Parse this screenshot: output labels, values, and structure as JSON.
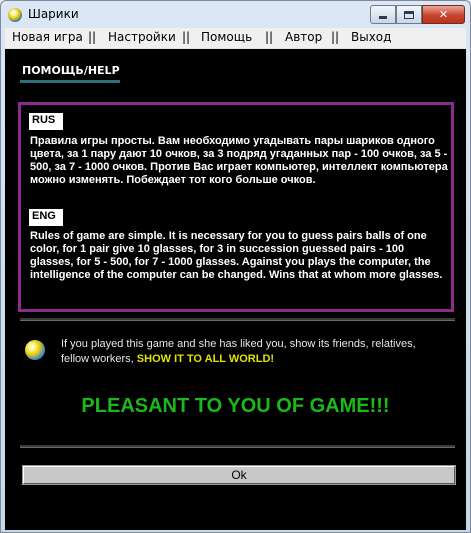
{
  "window": {
    "title": "Шарики",
    "close_glyph": "✕"
  },
  "menu": {
    "items": [
      {
        "label": "Новая игра"
      },
      {
        "label": "Настройки"
      },
      {
        "label": "Помощь"
      },
      {
        "label": "Автор"
      },
      {
        "label": "Выход"
      }
    ],
    "separator": "||"
  },
  "help": {
    "tab_label": "ПОМОЩЬ/HELP",
    "rus_tag": "RUS",
    "rus_text": "Правила игры просты. Вам необходимо угадывать пары шариков одного цвета, за 1 пару дают 10 очков, за 3 подряд угаданных пар - 100 очков, за 5 - 500, за 7 - 1000 очков. Против Вас играет компьютер, интеллект компьютера можно изменять. Побеждает тот кого больше очков.",
    "eng_tag": "ENG",
    "eng_text": "Rules of game are simple. It is necessary for you to guess pairs balls of one color, for 1 pair give 10 glasses, for 3 in succession guessed pairs - 100 glasses, for 5 - 500, for 7 - 1000 glasses. Against you plays the computer, the intelligence of the computer can be changed. Wins that at whom more glasses."
  },
  "share": {
    "text": "If you played this game and she has liked you, show its friends, relatives, fellow workers, ",
    "link": "SHOW IT TO ALL WORLD!"
  },
  "slogan": "PLEASANT TO YOU OF GAME!!!",
  "ok_button": "Ok",
  "colors": {
    "accent_border": "#8b2b8b",
    "slogan_green": "#1bb81b",
    "link_yellow": "#e2e200"
  }
}
